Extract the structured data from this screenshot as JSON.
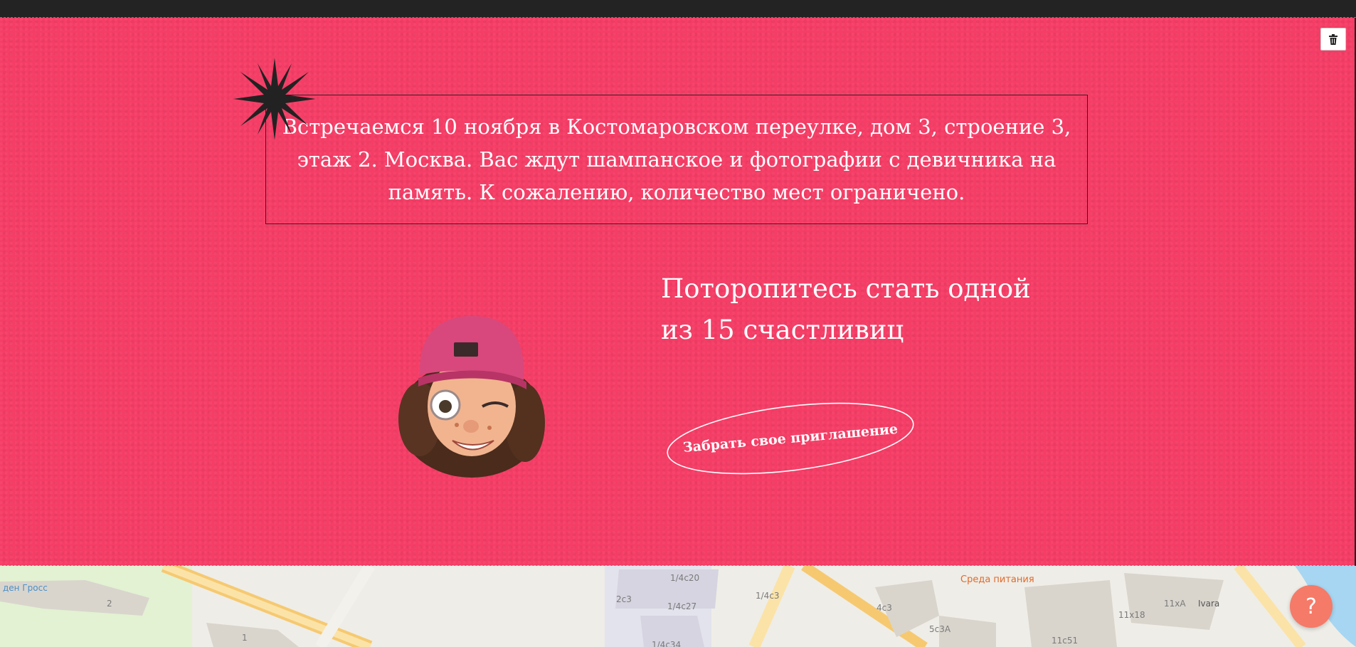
{
  "hero": {
    "info_text": "Встречаемся 10 ноября в Костомаровском переулке, дом 3, строение 3, этаж 2. Москва. Вас ждут шампанское и фотографии с девичника на память. К сожалению, количество мест ограничено.",
    "heading_line1": "Поторопитесь стать одной",
    "heading_line2": "из 15 счастливиц",
    "cta_label": "Забрать свое приглашение",
    "background_color": "#f53d66",
    "burst_color": "#222222"
  },
  "toolbar": {
    "delete_icon": "trash-icon"
  },
  "map": {
    "labels": {
      "store": "ден Гросс",
      "poi": "Среда питания",
      "ivara": "Ivara",
      "b1": "2",
      "b2": "1",
      "b3": "2с3",
      "b4": "1/4с20",
      "b5": "1/4с27",
      "b6": "1/4с3",
      "b7": "1/4с34",
      "b8": "4с3",
      "b9": "5с3А",
      "b10": "11х18",
      "b11": "11хА",
      "b12": "11с51"
    }
  },
  "help": {
    "label": "?"
  }
}
